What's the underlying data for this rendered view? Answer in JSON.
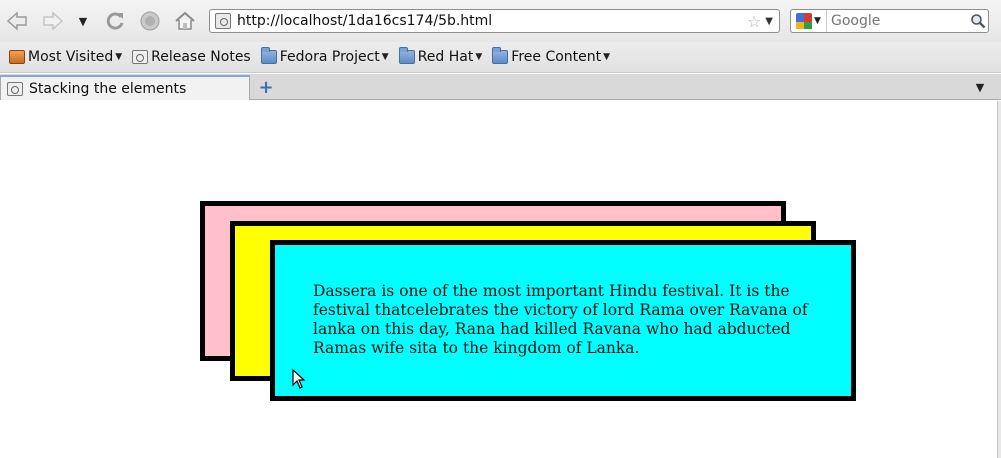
{
  "toolbar": {
    "url": "http://localhost/1da16cs174/5b.html",
    "search_placeholder": "Google"
  },
  "bookmarks": [
    {
      "label": "Most Visited",
      "icon": "smart-folder-icon",
      "has_dropdown": true
    },
    {
      "label": "Release Notes",
      "icon": "page-icon",
      "has_dropdown": false
    },
    {
      "label": "Fedora Project",
      "icon": "folder-icon",
      "has_dropdown": true
    },
    {
      "label": "Red Hat",
      "icon": "folder-icon",
      "has_dropdown": true
    },
    {
      "label": "Free Content",
      "icon": "folder-icon",
      "has_dropdown": true
    }
  ],
  "tabs": [
    {
      "label": "Stacking the elements",
      "active": true
    }
  ],
  "content": {
    "boxes": [
      {
        "color": "#ffc0cb"
      },
      {
        "color": "#ffff00"
      },
      {
        "color": "#00ffff"
      }
    ],
    "paragraph": "Dassera is one of the most important Hindu festival. It is the festival thatcelebrates the victory of lord Rama over Ravana of lanka on this day, Rana had killed Ravana who had abducted Ramas wife sita to the kingdom of Lanka."
  }
}
